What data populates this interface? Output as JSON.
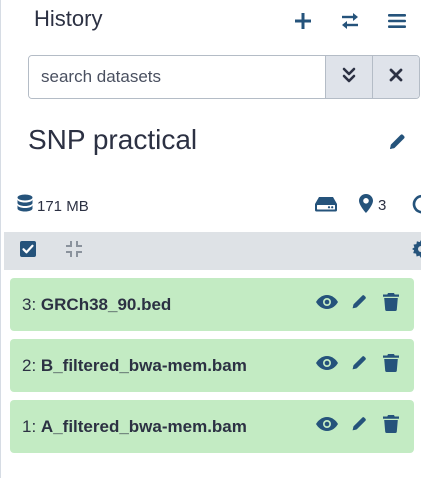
{
  "header": {
    "title": "History",
    "icons": {
      "create": "plus-icon",
      "switch": "exchange-icon",
      "options": "bars-icon"
    }
  },
  "search": {
    "placeholder": "search datasets",
    "value": "",
    "advanced_icon": "double-chevron-down-icon",
    "clear_icon": "close-icon"
  },
  "history": {
    "name": "SNP practical",
    "edit_icon": "pencil-icon"
  },
  "stats": {
    "size": "171 MB",
    "size_icon": "database-icon",
    "storage_icon": "hdd-icon",
    "visible_count": "3",
    "visible_icon": "map-marker-icon",
    "refresh_icon": "refresh-icon"
  },
  "toolbar": {
    "select_icon": "checkbox-checked-icon",
    "collapse_icon": "compress-icon",
    "settings_icon": "gear-icon"
  },
  "datasets": [
    {
      "hid": "3:",
      "name": "GRCh38_90.bed",
      "state": "ok"
    },
    {
      "hid": "2:",
      "name": "B_filtered_bwa-mem.bam",
      "state": "ok"
    },
    {
      "hid": "1:",
      "name": "A_filtered_bwa-mem.bam",
      "state": "ok"
    }
  ],
  "colors": {
    "dataset_ok_bg": "#c3ebc3",
    "toolbar_bg": "#dee2e6",
    "icon_color": "#25537b",
    "text": "#2c3143"
  }
}
